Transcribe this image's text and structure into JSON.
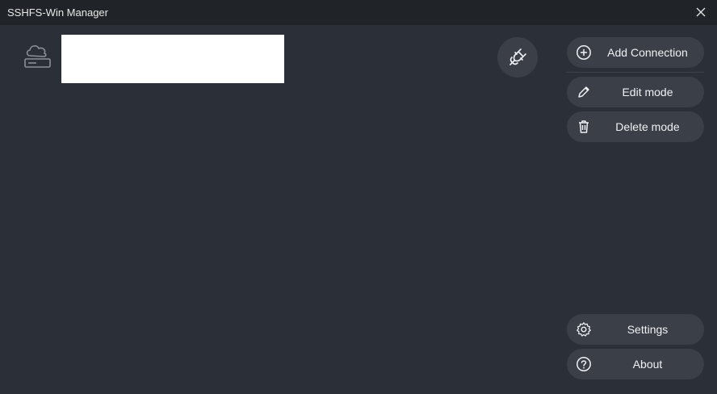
{
  "window": {
    "title": "SSHFS-Win Manager"
  },
  "connection": {
    "icon": "cloud-drive-icon",
    "name": ""
  },
  "actions": {
    "connect_icon": "plug-icon",
    "add": {
      "label": "Add Connection",
      "icon": "add-circle-icon"
    },
    "edit": {
      "label": "Edit mode",
      "icon": "pencil-icon"
    },
    "delete": {
      "label": "Delete mode",
      "icon": "trash-icon"
    },
    "settings": {
      "label": "Settings",
      "icon": "gear-icon"
    },
    "about": {
      "label": "About",
      "icon": "help-circle-icon"
    }
  },
  "colors": {
    "background": "#2b2f37",
    "titlebar": "#202328",
    "button": "#3a3f48",
    "text": "#f0f1f3"
  }
}
